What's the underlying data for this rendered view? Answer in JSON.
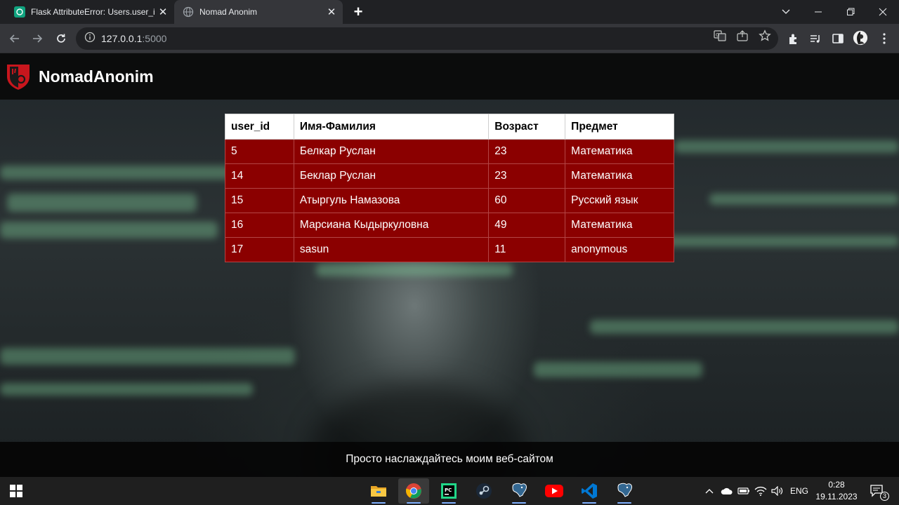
{
  "browser": {
    "tabs": [
      {
        "title": "Flask AttributeError: Users.user_i",
        "active": false
      },
      {
        "title": "Nomad Anonim",
        "active": true
      }
    ],
    "url_host": "127.0.0.1",
    "url_port": ":5000"
  },
  "site": {
    "brand": "NomadAnonim",
    "table": {
      "headers": [
        "user_id",
        "Имя-Фамилия",
        "Возраст",
        "Предмет"
      ],
      "rows": [
        [
          "5",
          "Белкар Руслан",
          "23",
          "Математика"
        ],
        [
          "14",
          "Беклар Руслан",
          "23",
          "Математика"
        ],
        [
          "15",
          "Атыргуль Намазова",
          "60",
          "Русский язык"
        ],
        [
          "16",
          "Марсиана Кыдыркуловна",
          "49",
          "Математика"
        ],
        [
          "17",
          "sasun",
          "11",
          "anonymous"
        ]
      ]
    },
    "footer_text": "Просто наслаждайтесь моим веб-сайтом"
  },
  "taskbar": {
    "apps": [
      "file-explorer",
      "chrome",
      "pycharm",
      "steam",
      "pgadmin",
      "youtube",
      "vscode",
      "pgadmin"
    ],
    "language": "ENG",
    "time": "0:28",
    "date": "19.11.2023",
    "notification_count": "3"
  },
  "colors": {
    "table_row_bg": "#8b0000",
    "table_header_bg": "#ffffff",
    "header_bg": "#0a0a0a"
  }
}
